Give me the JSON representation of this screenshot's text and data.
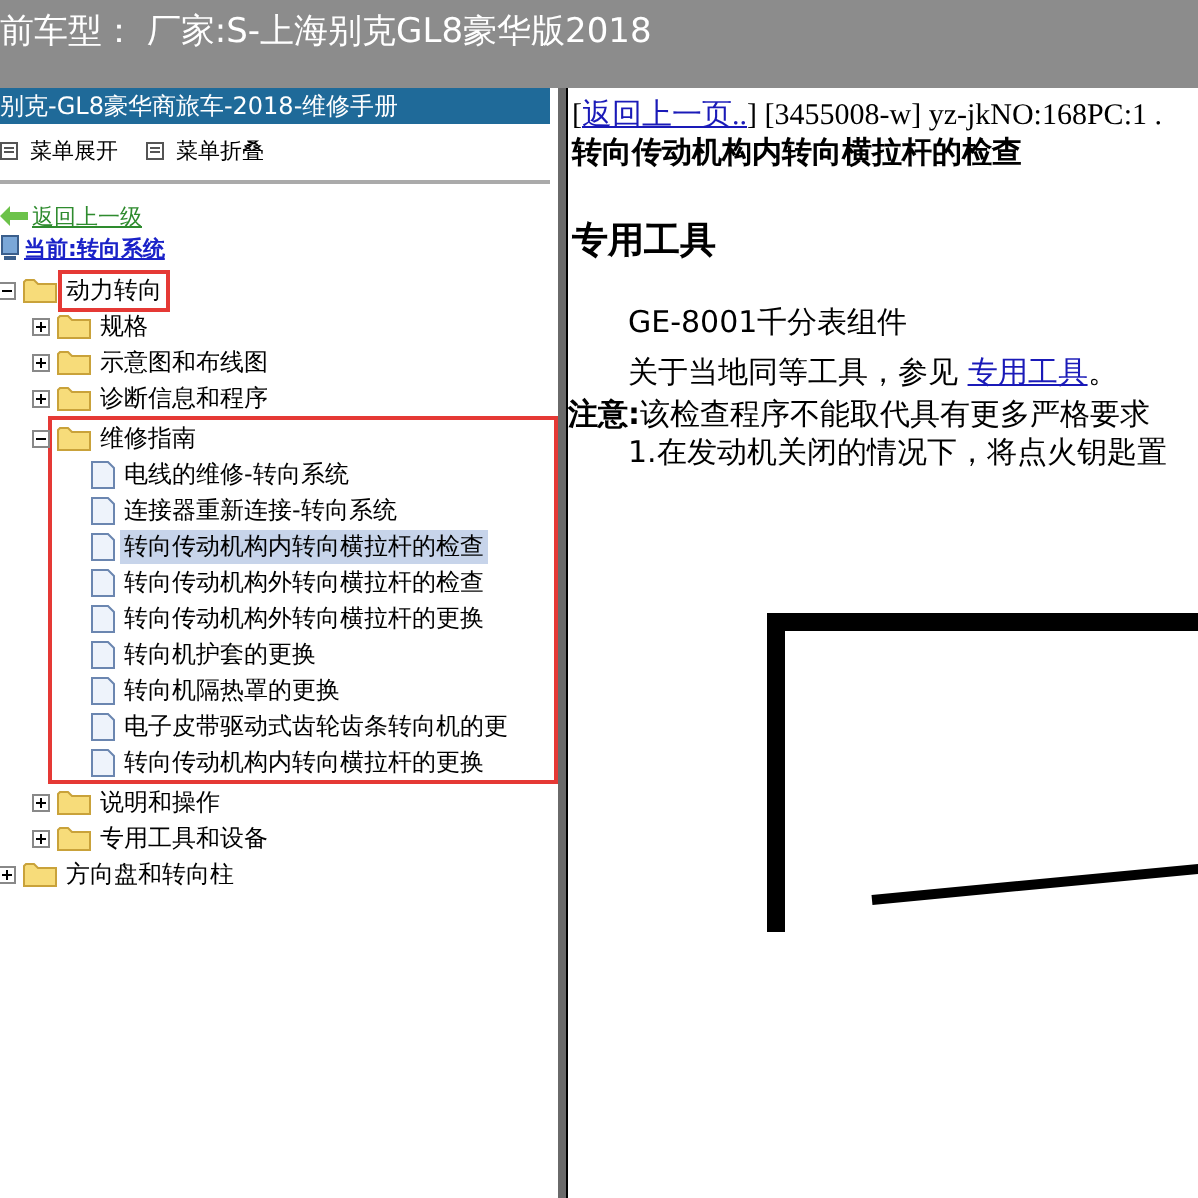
{
  "title_bar": {
    "text": "前车型： 厂家:S-上海别克GL8豪华版2018"
  },
  "panel_header": {
    "title": "别克-GL8豪华商旅车-2018-维修手册"
  },
  "toolbar": [
    {
      "label": "菜单展开"
    },
    {
      "label": "菜单折叠"
    }
  ],
  "back_link": "返回上一级",
  "current": "当前:转向系统",
  "tree": [
    {
      "label": "动力转向",
      "kind": "folder",
      "expanded": true,
      "boxed": true,
      "children": [
        {
          "label": "规格",
          "kind": "folder",
          "expanded": false
        },
        {
          "label": "示意图和布线图",
          "kind": "folder",
          "expanded": false
        },
        {
          "label": "诊断信息和程序",
          "kind": "folder",
          "expanded": false
        },
        {
          "label": "维修指南",
          "kind": "folder",
          "expanded": true,
          "branch_boxed": true,
          "children": [
            {
              "label": "电线的维修-转向系统",
              "kind": "document",
              "selected": false
            },
            {
              "label": "连接器重新连接-转向系统",
              "kind": "document",
              "selected": false
            },
            {
              "label": "转向传动机构内转向横拉杆的检查",
              "kind": "document",
              "selected": true
            },
            {
              "label": "转向传动机构外转向横拉杆的检查",
              "kind": "document",
              "selected": false
            },
            {
              "label": "转向传动机构外转向横拉杆的更换",
              "kind": "document",
              "selected": false
            },
            {
              "label": "转向机护套的更换",
              "kind": "document",
              "selected": false
            },
            {
              "label": "转向机隔热罩的更换",
              "kind": "document",
              "selected": false
            },
            {
              "label": "电子皮带驱动式齿轮齿条转向机的更",
              "kind": "document",
              "selected": false
            },
            {
              "label": "转向传动机构内转向横拉杆的更换",
              "kind": "document",
              "selected": false
            }
          ]
        },
        {
          "label": "说明和操作",
          "kind": "folder",
          "expanded": false
        },
        {
          "label": "专用工具和设备",
          "kind": "folder",
          "expanded": false
        }
      ]
    },
    {
      "label": "方向盘和转向柱",
      "kind": "folder",
      "expanded": false
    }
  ],
  "content": {
    "nav": {
      "before": "[",
      "link": "返回上一页..",
      "after": "] [3455008-w] yz-jkNO:168PC:1 ."
    },
    "title": "转向传动机构内转向横拉杆的检查",
    "section": "专用工具",
    "tool": "GE-8001千分表组件",
    "reference": {
      "before": "关于当地同等工具，参见 ",
      "link": "专用工具",
      "after": "。"
    },
    "note": "**注意:**该检查程序不能取代具有更多严格要求",
    "step": "1.在发动机关闭的情况下，将点火钥匙置"
  }
}
